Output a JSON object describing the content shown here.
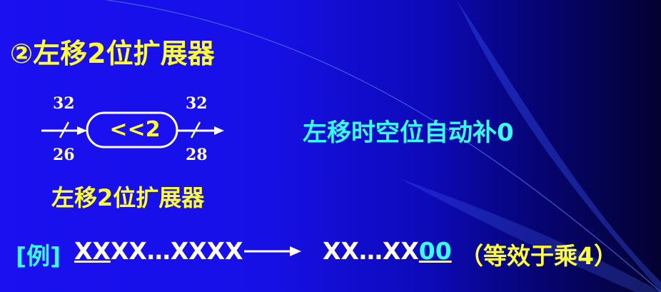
{
  "title": "②左移2位扩展器",
  "diagram": {
    "input_width_top": "32",
    "input_width_bottom": "26",
    "output_width_top": "32",
    "output_width_bottom": "28",
    "box_label": "<<2"
  },
  "note": "左移时空位自动补0",
  "caption": "左移2位扩展器",
  "example": {
    "label": "[例]",
    "input_highlight": "XX",
    "input_rest": "XX…XXXX",
    "output_prefix": "XX…XX",
    "output_highlight": "00",
    "remark": "（等效于乘4）"
  },
  "colors": {
    "title": "#ffff33",
    "note": "#33ffff",
    "text": "#ffffff"
  }
}
